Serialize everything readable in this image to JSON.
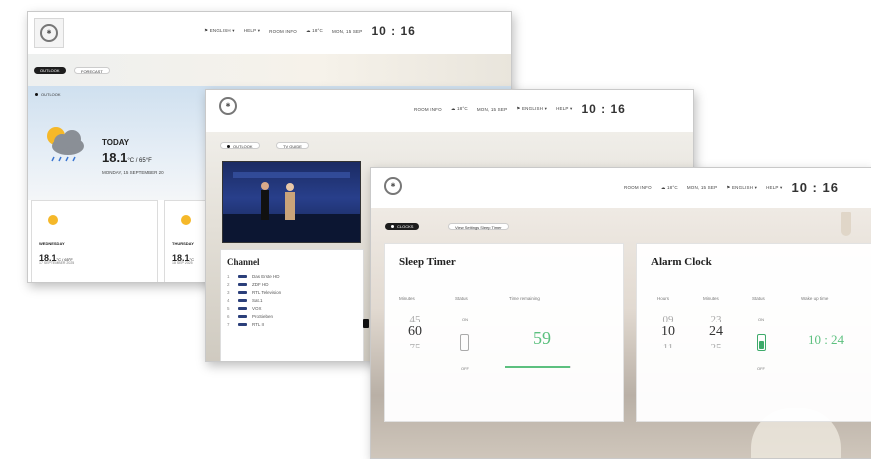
{
  "colors": {
    "accent_green": "#5cc07f",
    "dark": "#1d1d1d",
    "tv_blue": "#283f8b"
  },
  "weather_window": {
    "nav": {
      "language": "ENGLISH",
      "help": "HELP",
      "room_info": "ROOM INFO",
      "temp": "18°C",
      "date": "MON, 15 SEP",
      "clock": "10 : 16"
    },
    "tabs": [
      "OUTLOOK",
      "FORECAST"
    ],
    "location_label": "OUTLOOK",
    "today": {
      "label": "TODAY",
      "temp": "18.1",
      "unit": "°C / 65°F",
      "date": "MONDAY, 15 SEPTEMBER 20"
    },
    "forecast": [
      {
        "day": "WEDNESDAY",
        "temp": "18.1",
        "unit": "°C / 65°F",
        "date": "17 SEPTEMBER 2025"
      },
      {
        "day": "THURSDAY",
        "temp": "18.1",
        "unit": "°C",
        "date": "18 SEP 2025"
      }
    ]
  },
  "tv_window": {
    "nav": {
      "room_info": "ROOM INFO",
      "temp": "18°C",
      "date": "MON, 15 SEP",
      "language": "ENGLISH",
      "help": "HELP",
      "clock": "10 : 16"
    },
    "tabs": [
      "OUTLOOK",
      "TV GUIDE"
    ],
    "channel_title": "Channel",
    "channels": [
      {
        "n": "1",
        "name": "Das Erste HD"
      },
      {
        "n": "2",
        "name": "ZDF HD"
      },
      {
        "n": "3",
        "name": "RTL Television"
      },
      {
        "n": "4",
        "name": "Sat.1"
      },
      {
        "n": "5",
        "name": "VOX"
      },
      {
        "n": "6",
        "name": "ProSieben"
      },
      {
        "n": "7",
        "name": "RTL II"
      }
    ]
  },
  "alarm_window": {
    "nav": {
      "room_info": "ROOM INFO",
      "temp": "18°C",
      "date": "MON, 15 SEP",
      "language": "ENGLISH",
      "help": "HELP",
      "clock": "10 : 16"
    },
    "tabs": [
      "CLOCKS",
      "View Settings Sleep Timer"
    ],
    "sleep_timer": {
      "title": "Sleep Timer",
      "columns": {
        "minutes": "Minutes",
        "status": "Status",
        "remaining": "Time remaining"
      },
      "minutes": {
        "prev": "45",
        "current": "60",
        "next": "75"
      },
      "status_on": "ON",
      "status_off": "OFF",
      "remaining": "59",
      "remaining_progress": 0.98
    },
    "alarm_clock": {
      "title": "Alarm Clock",
      "columns": {
        "hours": "Hours",
        "minutes": "Minutes",
        "status": "Status",
        "wake": "Wake up time"
      },
      "hours": {
        "prev": "09",
        "current": "10",
        "next": "11"
      },
      "minutes": {
        "prev": "23",
        "current": "24",
        "next": "25"
      },
      "status_on": "ON",
      "status_off": "OFF",
      "wake_time": "10 : 24"
    }
  }
}
